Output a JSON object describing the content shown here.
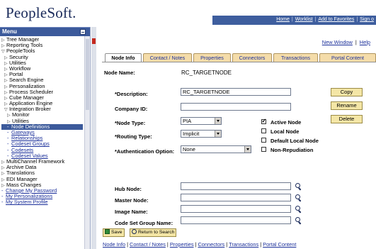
{
  "header": {
    "logo": "PeopleSoft.",
    "links": [
      "Home",
      "Worklist",
      "Add to Favorites",
      "Sign o"
    ]
  },
  "menu": {
    "title": "Menu",
    "items": [
      {
        "label": "Tree Manager",
        "level": 1,
        "expander": "closed"
      },
      {
        "label": "Reporting Tools",
        "level": 1,
        "expander": "closed"
      },
      {
        "label": "PeopleTools",
        "level": 1,
        "expander": "open"
      },
      {
        "label": "Security",
        "level": 2,
        "expander": "closed"
      },
      {
        "label": "Utilities",
        "level": 2,
        "expander": "closed"
      },
      {
        "label": "Workflow",
        "level": 2,
        "expander": "closed"
      },
      {
        "label": "Portal",
        "level": 2,
        "expander": "closed"
      },
      {
        "label": "Search Engine",
        "level": 2,
        "expander": "closed"
      },
      {
        "label": "Personalization",
        "level": 2,
        "expander": "closed"
      },
      {
        "label": "Process Scheduler",
        "level": 2,
        "expander": "closed"
      },
      {
        "label": "Cube Manager",
        "level": 2,
        "expander": "closed"
      },
      {
        "label": "Application Engine",
        "level": 2,
        "expander": "closed"
      },
      {
        "label": "Integration Broker",
        "level": 2,
        "expander": "open"
      },
      {
        "label": "Monitor",
        "level": 3,
        "expander": "closed"
      },
      {
        "label": "Utilities",
        "level": 3,
        "expander": "closed"
      },
      {
        "label": "Node Definitions",
        "level": 3,
        "link": true,
        "selected": true
      },
      {
        "label": "Gateways",
        "level": 3,
        "link": true
      },
      {
        "label": "Relationships",
        "level": 3,
        "link": true
      },
      {
        "label": "Codeset Groups",
        "level": 3,
        "link": true
      },
      {
        "label": "Codesets",
        "level": 3,
        "link": true
      },
      {
        "label": "Codeset Values",
        "level": 3,
        "link": true
      },
      {
        "label": "MultiChannel Framework",
        "level": 1,
        "expander": "closed"
      },
      {
        "label": "Archive Data",
        "level": 1,
        "expander": "closed"
      },
      {
        "label": "Translations",
        "level": 1,
        "expander": "closed"
      },
      {
        "label": "EDI Manager",
        "level": 1,
        "expander": "closed"
      },
      {
        "label": "Mass Changes",
        "level": 1,
        "expander": "closed"
      },
      {
        "label": "Change My Password",
        "level": 0,
        "link": true
      },
      {
        "label": "My Personalizations",
        "level": 0,
        "link": true
      },
      {
        "label": "My System Profile",
        "level": 0,
        "link": true
      }
    ]
  },
  "content": {
    "new_window": "New Window",
    "help": "Help",
    "tabs": [
      "Node Info",
      "Contact / Notes",
      "Properties",
      "Connectors",
      "Transactions",
      "Portal Content"
    ],
    "active_tab": 0,
    "node_name_label": "Node Name:",
    "node_name_value": "RC_TARGETNODE",
    "fields": {
      "description_label": "*Description:",
      "description_value": "RC_TARGETNODE",
      "company_label": "Company ID:",
      "company_value": "",
      "node_type_label": "*Node Type:",
      "node_type_value": "PIA",
      "routing_label": "*Routing Type:",
      "routing_value": "Implicit",
      "auth_label": "*Authentication Option:",
      "auth_value": "None",
      "hub_label": "Hub Node:",
      "hub_value": "",
      "master_label": "Master Node:",
      "master_value": "",
      "image_label": "Image Name:",
      "image_value": "",
      "codeset_label": "Code Set Group Name:",
      "codeset_value": ""
    },
    "checkboxes": {
      "active_node": {
        "label": "Active Node",
        "checked": true
      },
      "local_node": {
        "label": "Local Node",
        "checked": false
      },
      "default_local": {
        "label": "Default Local Node",
        "checked": false
      },
      "non_repudiation": {
        "label": "Non-Repudiation",
        "checked": false
      }
    },
    "buttons": {
      "copy": "Copy",
      "rename": "Rename",
      "delete": "Delete",
      "save": "Save",
      "return_to_search": "Return to Search"
    },
    "footer_links": [
      "Node Info",
      "Contact / Notes",
      "Properties",
      "Connectors",
      "Transactions",
      "Portal Content"
    ]
  }
}
